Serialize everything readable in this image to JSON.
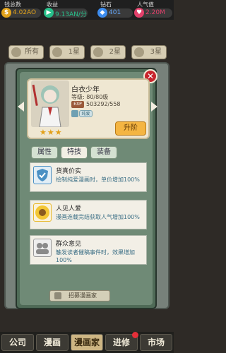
{
  "stats": [
    {
      "label": "钱总数",
      "value": "4.02AO",
      "icon": "coin-icon",
      "color": "#e0a21b"
    },
    {
      "label": "收益",
      "value": "9.13AN/分",
      "icon": "income-icon",
      "color": "#27c08b"
    },
    {
      "label": "钻石",
      "value": "401",
      "icon": "diamond-icon",
      "color": "#3c8df0"
    },
    {
      "label": "人气值",
      "value": "2.20M",
      "icon": "heart-icon",
      "color": "#e2406b"
    }
  ],
  "bg_tabs": [
    "所有",
    "1星",
    "2星",
    "3星"
  ],
  "character": {
    "name": "白衣少年",
    "level": "等级:  80/80级",
    "exp_label": "EXP",
    "exp": "503292/558",
    "rarity": "纯爱",
    "stars": "★★★",
    "upgrade_label": "升阶"
  },
  "subtabs": [
    "属性",
    "特技",
    "装备"
  ],
  "skills": [
    {
      "name": "货真价实",
      "desc": "绘制纯爱漫画时，单价增加100%",
      "icon": "shield-icon",
      "color": "#4a90c4"
    },
    {
      "name": "人见人爱",
      "desc": "漫画连载完结获取人气增加100%",
      "icon": "sunflower-icon",
      "color": "#e9b92c"
    },
    {
      "name": "群众意见",
      "desc": "触发读者催稿事件时，效果增加100%",
      "icon": "crowd-icon",
      "color": "#9a9a9a"
    }
  ],
  "recruit_label": "招募漫画家",
  "close_label": "✕",
  "nav": [
    {
      "label": "公司",
      "active": false
    },
    {
      "label": "漫画",
      "active": false
    },
    {
      "label": "漫画家",
      "active": true
    },
    {
      "label": "进修",
      "active": false
    },
    {
      "label": "市场",
      "active": false
    }
  ]
}
